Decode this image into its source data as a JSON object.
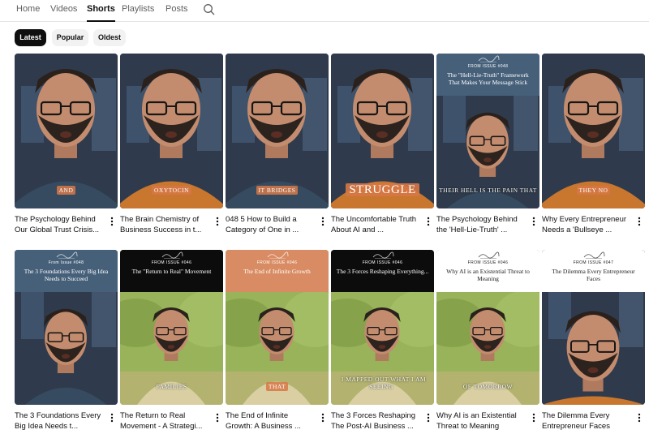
{
  "tabs": [
    {
      "label": "Home"
    },
    {
      "label": "Videos"
    },
    {
      "label": "Shorts"
    },
    {
      "label": "Playlists"
    },
    {
      "label": "Posts"
    }
  ],
  "chips": [
    {
      "label": "Latest"
    },
    {
      "label": "Popular"
    },
    {
      "label": "Oldest"
    }
  ],
  "shorts": [
    {
      "title": "The Psychology Behind Our Global Trust Crisis...",
      "caption": "AND",
      "style": "closeup"
    },
    {
      "title": "The Brain Chemistry of Business Success in t...",
      "caption": "OXYTOCIN",
      "style": "closeup"
    },
    {
      "title": "048 5   How to Build a Category of One in ...",
      "caption": "IT BRIDGES",
      "style": "closeup"
    },
    {
      "title": "The Uncomfortable Truth About AI and ...",
      "caption": "STRUGGLE",
      "style": "closeup"
    },
    {
      "title": "The Psychology Behind the 'Hell-Lie-Truth' ...",
      "caption": "THEIR HELL IS THE PAIN THAT",
      "banner_small": "FROM ISSUE #048",
      "banner_big": "The \"Hell-Lie-Truth\" Framework That Makes Your Message Stick",
      "style": "banner-blue"
    },
    {
      "title": "Why Every Entrepreneur Needs a 'Bullseye ...",
      "caption": "THEY NO",
      "style": "closeup"
    },
    {
      "title": "The 3 Foundations Every Big Idea Needs t...",
      "caption": "",
      "banner_small": "From Issue #048",
      "banner_big": "The 3 Foundations Every Big Idea Needs to Succeed",
      "style": "banner-blue"
    },
    {
      "title": "The Return to Real Movement - A Strategi...",
      "caption": "FAMILIES",
      "banner_small": "FROM ISSUE #046",
      "banner_big": "The \"Return to Real\" Movement",
      "style": "banner-black"
    },
    {
      "title": "The End of Infinite Growth: A Business ...",
      "caption": "THAT",
      "banner_small": "FROM ISSUE #046",
      "banner_big": "The End of Infinite Growth",
      "style": "banner-orange"
    },
    {
      "title": "The 3 Forces Reshaping The Post-AI Business ...",
      "caption": "I MAPPED OUT WHAT I AM SEEING",
      "banner_small": "FROM ISSUE #046",
      "banner_big": "The 3 Forces Reshaping Everything...",
      "style": "banner-black"
    },
    {
      "title": "Why AI is an Existential Threat to Meaning",
      "caption": "OF TOMORROW",
      "banner_small": "FROM ISSUE #046",
      "banner_big": "Why AI is an Existential Threat to Meaning",
      "style": "banner-white"
    },
    {
      "title": "The Dilemma Every Entrepreneur Faces",
      "caption": "",
      "banner_small": "FROM ISSUE #047",
      "banner_big": "The Dilemma Every Entrepreneur Faces",
      "style": "banner-white-closeup"
    }
  ]
}
